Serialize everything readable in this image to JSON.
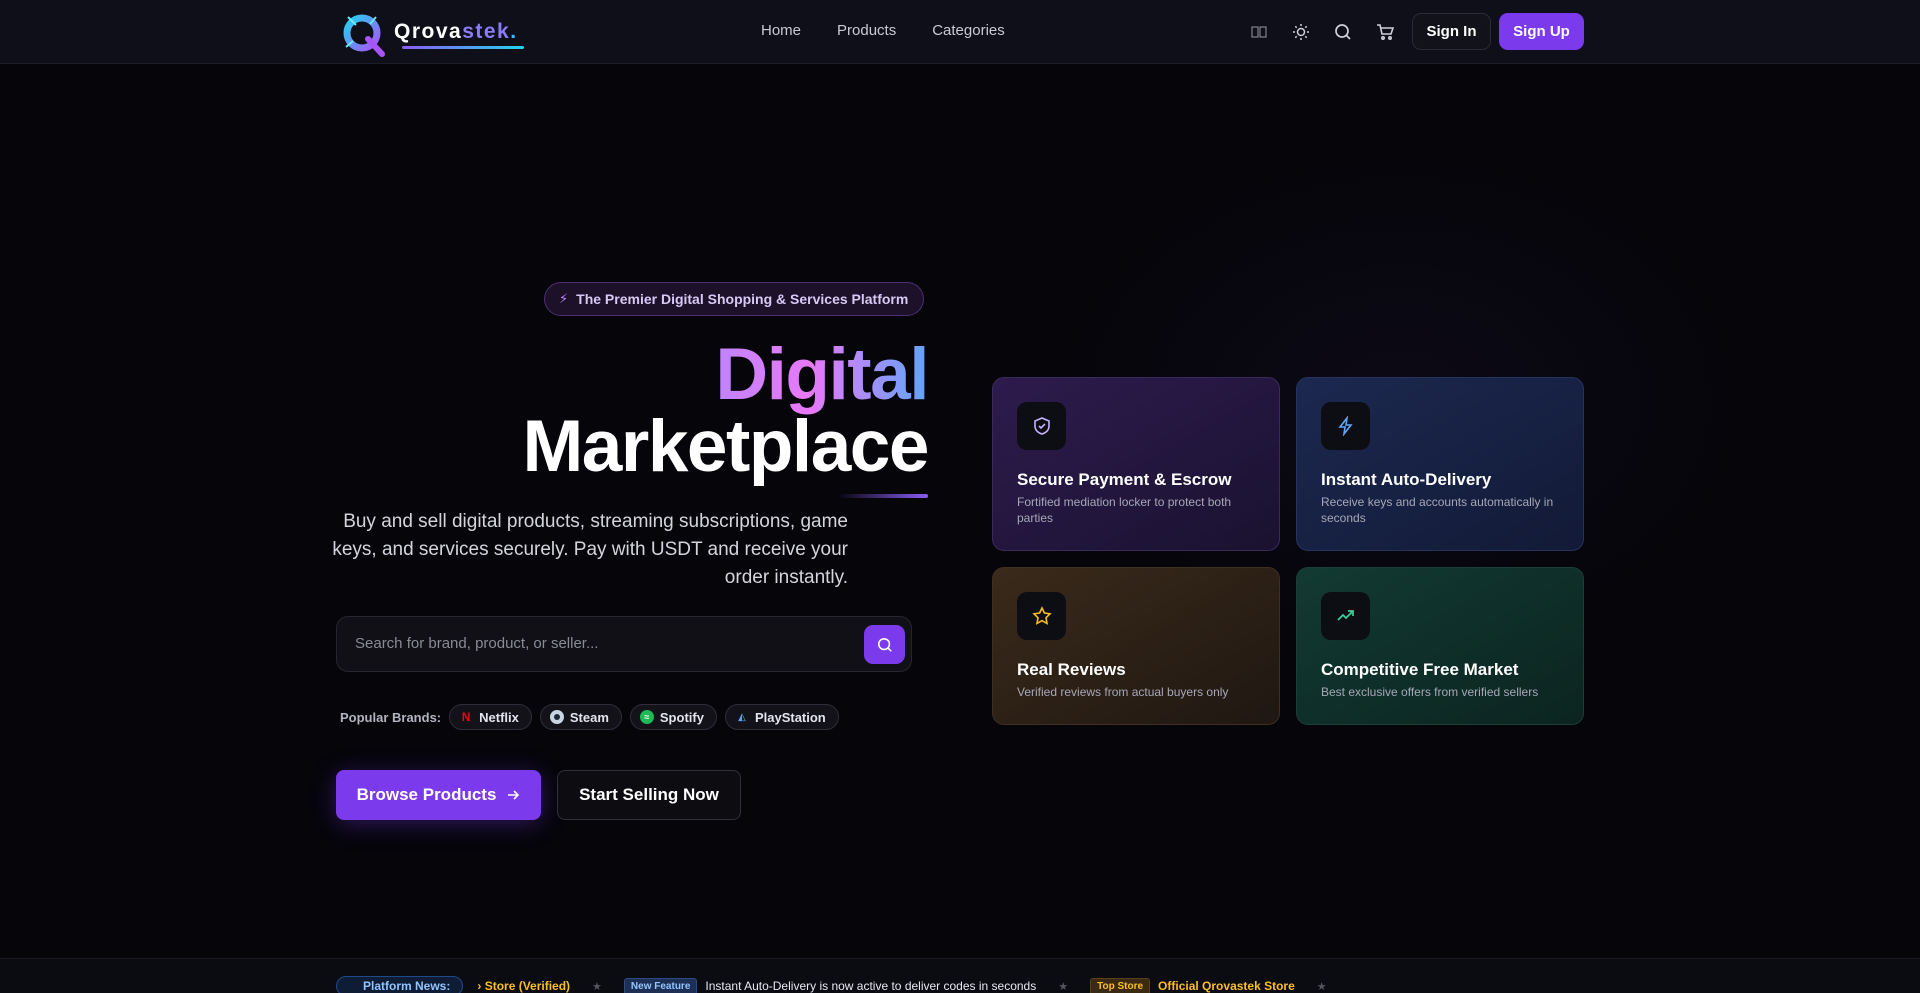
{
  "brand": {
    "name_part1": "Qrova",
    "name_part2": "stek",
    "name_dot": "."
  },
  "nav": {
    "items": [
      "Home",
      "Products",
      "Categories"
    ]
  },
  "header": {
    "icons": [
      "language-flag-icon",
      "theme-toggle-icon",
      "search-icon",
      "cart-icon"
    ],
    "signin_label": "Sign In",
    "signup_label": "Sign Up"
  },
  "hero": {
    "badge": "The Premier Digital Shopping & Services Platform",
    "title_line1": "Digital",
    "title_line2": "Marketplace",
    "subtitle": "Buy and sell digital products, streaming subscriptions, game keys, and services securely. Pay with USDT and receive your order instantly.",
    "search_placeholder": "Search for brand, product, or seller...",
    "popular_label": "Popular Brands:",
    "brands": [
      {
        "name": "Netflix",
        "color": "#e50914",
        "icon": "netflix-icon"
      },
      {
        "name": "Steam",
        "color": "#2a475e",
        "icon": "steam-icon"
      },
      {
        "name": "Spotify",
        "color": "#1db954",
        "icon": "spotify-icon"
      },
      {
        "name": "PlayStation",
        "color": "#0070d1",
        "icon": "playstation-icon"
      }
    ],
    "browse_label": "Browse Products",
    "sell_label": "Start Selling Now"
  },
  "features": [
    {
      "title": "Secure Payment & Escrow",
      "desc": "Fortified mediation locker to protect both parties",
      "icon": "shield-check-icon",
      "accent": "#c4b5fd"
    },
    {
      "title": "Instant Auto-Delivery",
      "desc": "Receive keys and accounts automatically in seconds",
      "icon": "lightning-icon",
      "accent": "#60a5fa"
    },
    {
      "title": "Real Reviews",
      "desc": "Verified reviews from actual buyers only",
      "icon": "star-icon",
      "accent": "#fbbf24"
    },
    {
      "title": "Competitive Free Market",
      "desc": "Best exclusive offers from verified sellers",
      "icon": "trending-up-icon",
      "accent": "#34d399"
    }
  ],
  "ticker": {
    "label": "Platform News:",
    "item1": "› Store (Verified)",
    "tag2": "New Feature",
    "item2": "Instant Auto-Delivery is now active to deliver codes in seconds",
    "tag3": "Top Store",
    "item3": "Official Qrovastek Store"
  }
}
